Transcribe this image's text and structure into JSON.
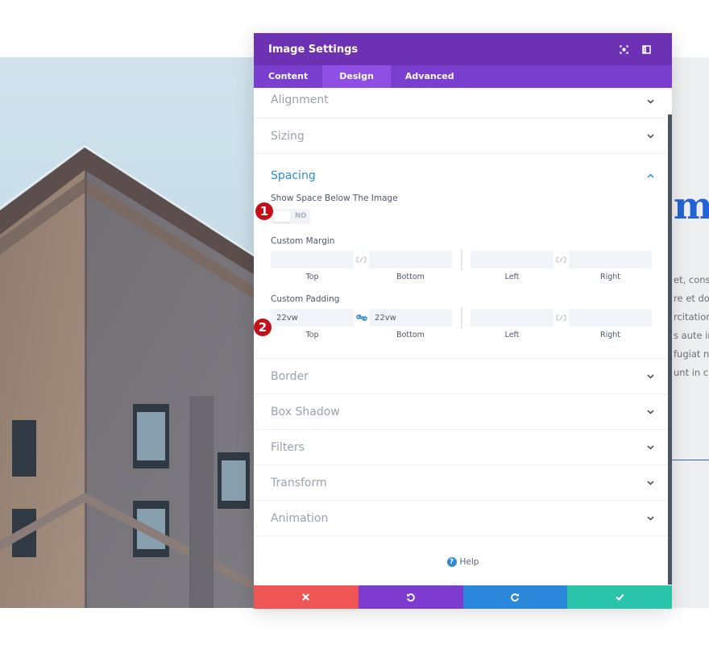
{
  "modal": {
    "title": "Image Settings",
    "header_icons": [
      "focus-mode-icon",
      "split-view-icon"
    ],
    "tabs": [
      {
        "label": "Content",
        "active": false
      },
      {
        "label": "Design",
        "active": true
      },
      {
        "label": "Advanced",
        "active": false
      }
    ],
    "sections_top": [
      {
        "title": "Alignment",
        "expanded": false
      },
      {
        "title": "Sizing",
        "expanded": false
      }
    ],
    "spacing": {
      "title": "Spacing",
      "expanded": true,
      "show_space_label": "Show Space Below The Image",
      "show_space_value": "NO",
      "custom_margin": {
        "label": "Custom Margin",
        "top": "",
        "bottom": "",
        "left": "",
        "right": "",
        "labels": {
          "top": "Top",
          "bottom": "Bottom",
          "left": "Left",
          "right": "Right"
        },
        "linked_top_bottom": false,
        "linked_left_right": false
      },
      "custom_padding": {
        "label": "Custom Padding",
        "top": "22vw",
        "bottom": "22vw",
        "left": "",
        "right": "",
        "labels": {
          "top": "Top",
          "bottom": "Bottom",
          "left": "Left",
          "right": "Right"
        },
        "linked_top_bottom": true,
        "linked_left_right": false
      }
    },
    "sections_bottom": [
      {
        "title": "Border",
        "expanded": false
      },
      {
        "title": "Box Shadow",
        "expanded": false
      },
      {
        "title": "Filters",
        "expanded": false
      },
      {
        "title": "Transform",
        "expanded": false
      },
      {
        "title": "Animation",
        "expanded": false
      }
    ],
    "help_label": "Help",
    "footer_buttons": [
      {
        "name": "discard",
        "icon": "close-icon",
        "color": "#ef5555"
      },
      {
        "name": "undo",
        "icon": "undo-icon",
        "color": "#7e3bd0"
      },
      {
        "name": "redo",
        "icon": "redo-icon",
        "color": "#2b87da"
      },
      {
        "name": "save",
        "icon": "check-icon",
        "color": "#29c4a9"
      }
    ]
  },
  "annotations": [
    {
      "number": "1",
      "target": "show-space-toggle"
    },
    {
      "number": "2",
      "target": "custom-padding-top"
    }
  ],
  "background_page": {
    "heading_fragment": "m I",
    "text_fragments": [
      "et, consec",
      "re et dolo",
      "rcitation",
      "s aute irur",
      "fugiat n",
      "unt in culp"
    ]
  },
  "colors": {
    "header": "#6c32b3",
    "tabs": "#7b3fd0",
    "tab_active": "#8f4fe4",
    "accent_blue": "#2e8ad0",
    "annotation_red": "#c5101a"
  }
}
